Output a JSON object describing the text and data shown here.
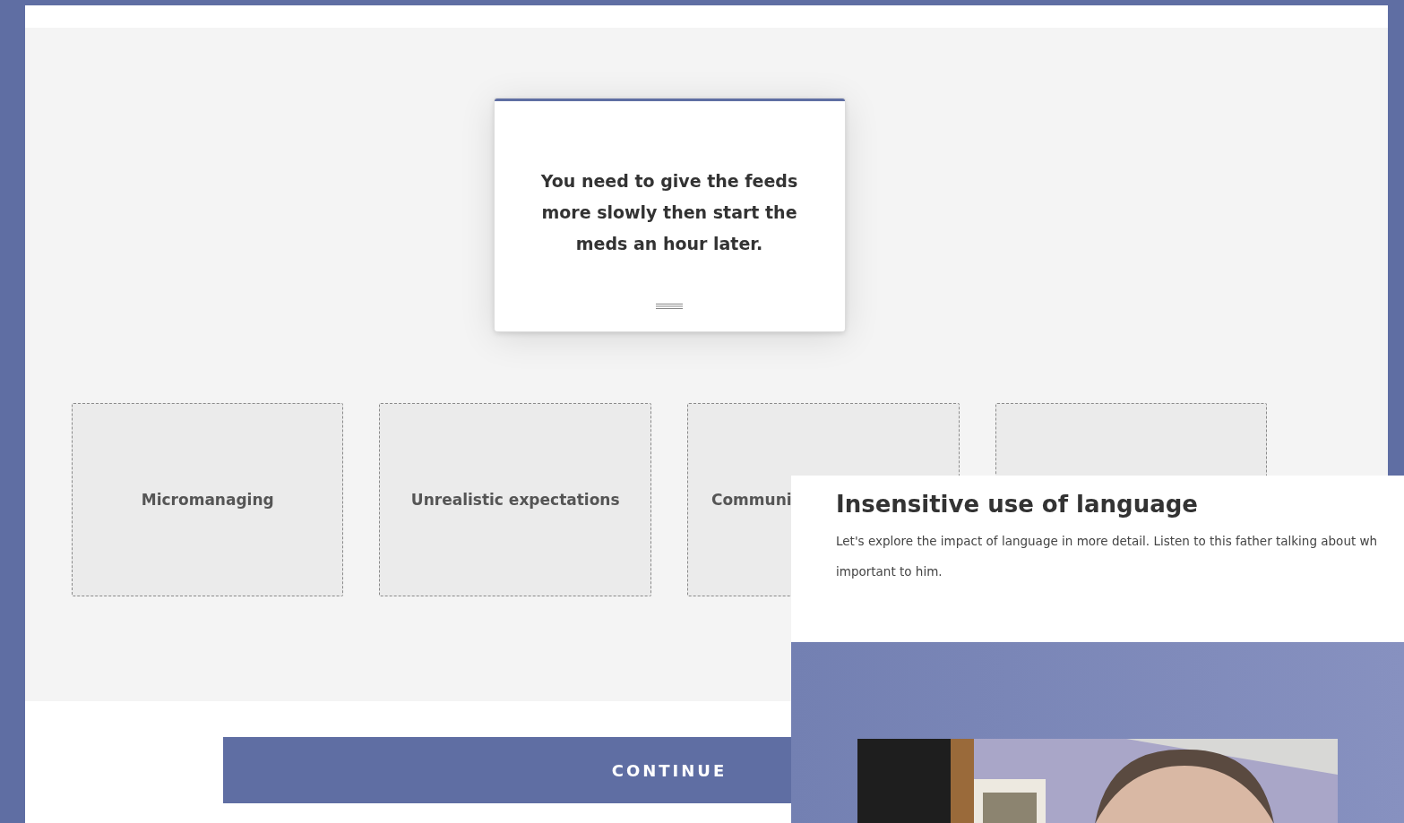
{
  "prompt_card": {
    "text": "You need to give the feeds more slowly then start the meds an hour later."
  },
  "drop_zones": [
    {
      "kind": "labeled",
      "label": "Micromanaging"
    },
    {
      "kind": "labeled",
      "label": "Unrealistic expectations"
    },
    {
      "kind": "cut",
      "label": "Communi"
    },
    {
      "kind": "empty"
    }
  ],
  "continue_button": {
    "label": "CONTINUE"
  },
  "overlay": {
    "title": "Insensitive use of language",
    "body_lines": [
      "Let's explore the impact of language in more detail. Listen to this father talking about wh",
      "important to him."
    ]
  }
}
